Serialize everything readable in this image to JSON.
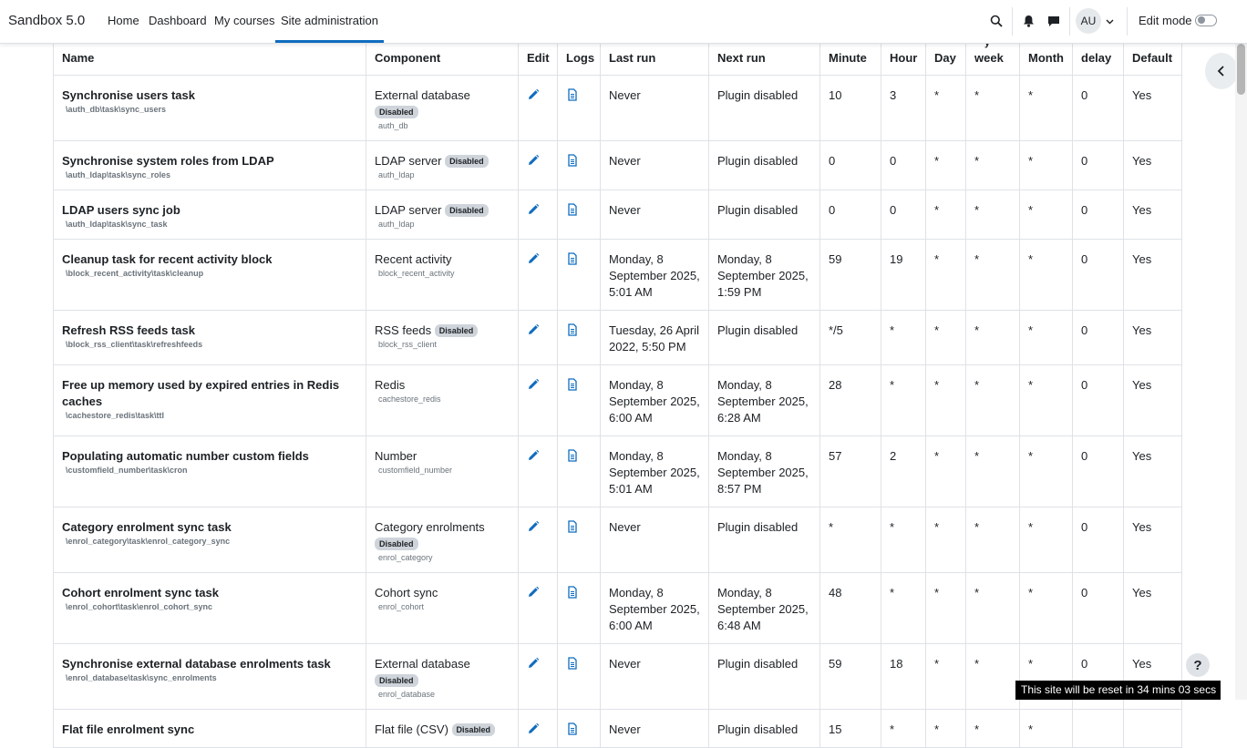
{
  "navbar": {
    "brand": "Sandbox 5.0",
    "links": [
      "Home",
      "Dashboard",
      "My courses",
      "Site administration"
    ],
    "active_link": "Site administration",
    "avatar_initials": "AU",
    "edit_mode_label": "Edit mode"
  },
  "table": {
    "headers": [
      "Name",
      "Component",
      "Edit",
      "Logs",
      "Last run",
      "Next run",
      "Minute",
      "Hour",
      "Day",
      "week",
      "Month",
      "delay",
      "Default"
    ],
    "rows": [
      {
        "name": "Synchronise users task",
        "classname": "\\auth_db\\task\\sync_users",
        "component": "External database",
        "disabled": true,
        "badge_block": true,
        "component_sub": "auth_db",
        "last_run": "Never",
        "next_run": "Plugin disabled",
        "minute": "10",
        "hour": "3",
        "day": "*",
        "dow": "*",
        "month": "*",
        "delay": "0",
        "default": "Yes"
      },
      {
        "name": "Synchronise system roles from LDAP",
        "classname": "\\auth_ldap\\task\\sync_roles",
        "component": "LDAP server",
        "disabled": true,
        "badge_block": false,
        "component_sub": "auth_ldap",
        "last_run": "Never",
        "next_run": "Plugin disabled",
        "minute": "0",
        "hour": "0",
        "day": "*",
        "dow": "*",
        "month": "*",
        "delay": "0",
        "default": "Yes"
      },
      {
        "name": "LDAP users sync job",
        "classname": "\\auth_ldap\\task\\sync_task",
        "component": "LDAP server",
        "disabled": true,
        "badge_block": false,
        "component_sub": "auth_ldap",
        "last_run": "Never",
        "next_run": "Plugin disabled",
        "minute": "0",
        "hour": "0",
        "day": "*",
        "dow": "*",
        "month": "*",
        "delay": "0",
        "default": "Yes"
      },
      {
        "name": "Cleanup task for recent activity block",
        "classname": "\\block_recent_activity\\task\\cleanup",
        "component": "Recent activity",
        "disabled": false,
        "badge_block": false,
        "component_sub": "block_recent_activity",
        "last_run": "Monday, 8 September 2025, 5:01 AM",
        "next_run": "Monday, 8 September 2025, 1:59 PM",
        "minute": "59",
        "hour": "19",
        "day": "*",
        "dow": "*",
        "month": "*",
        "delay": "0",
        "default": "Yes"
      },
      {
        "name": "Refresh RSS feeds task",
        "classname": "\\block_rss_client\\task\\refreshfeeds",
        "component": "RSS feeds",
        "disabled": true,
        "badge_block": false,
        "component_sub": "block_rss_client",
        "last_run": "Tuesday, 26 April 2022, 5:50 PM",
        "next_run": "Plugin disabled",
        "minute": "*/5",
        "hour": "*",
        "day": "*",
        "dow": "*",
        "month": "*",
        "delay": "0",
        "default": "Yes"
      },
      {
        "name": "Free up memory used by expired entries in Redis caches",
        "classname": "\\cachestore_redis\\task\\ttl",
        "component": "Redis",
        "disabled": false,
        "badge_block": false,
        "component_sub": "cachestore_redis",
        "last_run": "Monday, 8 September 2025, 6:00 AM",
        "next_run": "Monday, 8 September 2025, 6:28 AM",
        "minute": "28",
        "hour": "*",
        "day": "*",
        "dow": "*",
        "month": "*",
        "delay": "0",
        "default": "Yes"
      },
      {
        "name": "Populating automatic number custom fields",
        "classname": "\\customfield_number\\task\\cron",
        "component": "Number",
        "disabled": false,
        "badge_block": false,
        "component_sub": "customfield_number",
        "last_run": "Monday, 8 September 2025, 5:01 AM",
        "next_run": "Monday, 8 September 2025, 8:57 PM",
        "minute": "57",
        "hour": "2",
        "day": "*",
        "dow": "*",
        "month": "*",
        "delay": "0",
        "default": "Yes"
      },
      {
        "name": "Category enrolment sync task",
        "classname": "\\enrol_category\\task\\enrol_category_sync",
        "component": "Category enrolments",
        "disabled": true,
        "badge_block": true,
        "component_sub": "enrol_category",
        "last_run": "Never",
        "next_run": "Plugin disabled",
        "minute": "*",
        "hour": "*",
        "day": "*",
        "dow": "*",
        "month": "*",
        "delay": "0",
        "default": "Yes"
      },
      {
        "name": "Cohort enrolment sync task",
        "classname": "\\enrol_cohort\\task\\enrol_cohort_sync",
        "component": "Cohort sync",
        "disabled": false,
        "badge_block": false,
        "component_sub": "enrol_cohort",
        "last_run": "Monday, 8 September 2025, 6:00 AM",
        "next_run": "Monday, 8 September 2025, 6:48 AM",
        "minute": "48",
        "hour": "*",
        "day": "*",
        "dow": "*",
        "month": "*",
        "delay": "0",
        "default": "Yes"
      },
      {
        "name": "Synchronise external database enrolments task",
        "classname": "\\enrol_database\\task\\sync_enrolments",
        "component": "External database",
        "disabled": true,
        "badge_block": true,
        "component_sub": "enrol_database",
        "last_run": "Never",
        "next_run": "Plugin disabled",
        "minute": "59",
        "hour": "18",
        "day": "*",
        "dow": "*",
        "month": "*",
        "delay": "0",
        "default": "Yes"
      },
      {
        "name": "Flat file enrolment sync",
        "classname": "",
        "component": "Flat file (CSV)",
        "disabled": true,
        "badge_block": false,
        "component_sub": "",
        "last_run": "Never",
        "next_run": "Plugin disabled",
        "minute": "15",
        "hour": "*",
        "day": "*",
        "dow": "*",
        "month": "*",
        "delay": "",
        "default": ""
      }
    ],
    "disabled_label": "Disabled"
  },
  "help_label": "?",
  "reset_banner": "This site will be reset in 34 mins 03 secs",
  "colors": {
    "accent": "#0f6cbf",
    "border": "#dee2e6",
    "badge": "#ced4da"
  }
}
